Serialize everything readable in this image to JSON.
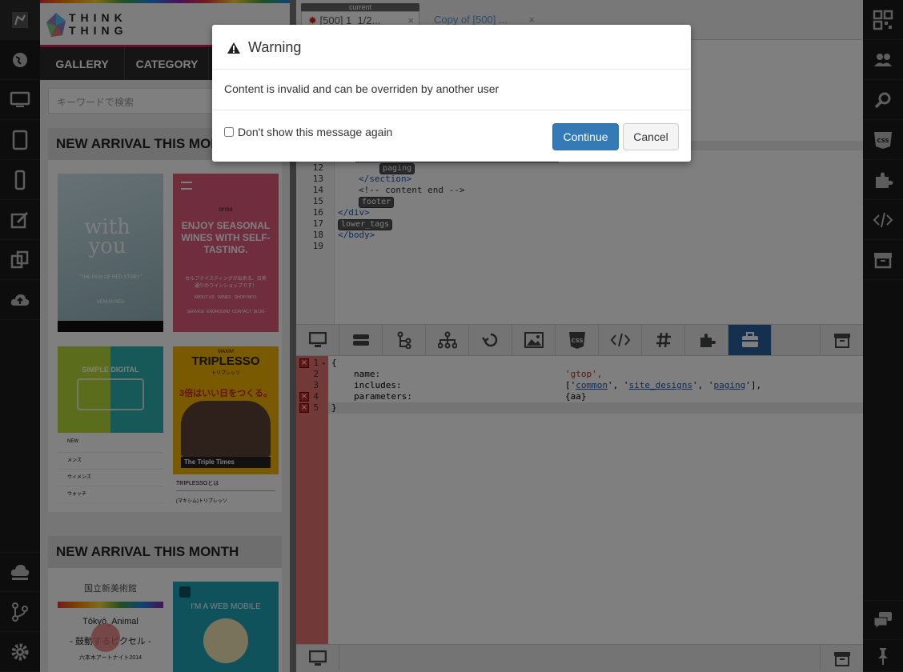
{
  "preview": {
    "logo_line1": "THINK",
    "logo_line2": "THING",
    "nav": [
      "GALLERY",
      "CATEGORY"
    ],
    "search_placeholder": "キーワードで検索",
    "section1_title": "NEW ARRIVAL THIS MONTH",
    "section2_title": "NEW ARRIVAL THIS MONTH",
    "thumb1": {
      "title1": "with",
      "title2": "you",
      "sub": "\"THE FILM OF RED STORY\"",
      "brand": "VENUS RED"
    },
    "thumb2": {
      "brand": "ornis",
      "headline": "ENJOY SEASONAL WINES WITH SELF-TASTING.",
      "jp": "セルフテイスティングが出来る、日美通りのワインショップです！",
      "links1": "ABOUT US   WINES   SHOP INFO.",
      "links2": "SERVICE  ENOROUND  CONTACT  BLOG"
    },
    "thumb3": {
      "title": "SIMPLE DIGITAL",
      "menu": [
        "NEW",
        "メンズ",
        "ウィメンズ",
        "ウォッチ"
      ]
    },
    "thumb4": {
      "small": "MAXIM",
      "title": "TRIPLESSO",
      "kana": "トリプレッソ",
      "jp": "3倍はいい日をつくる。",
      "banner": "The Triple Times",
      "link1": "TRIPLESSOとは",
      "link2": "(マキシム)トリプレッソ"
    },
    "thumb5": {
      "museum": "国立新美術館",
      "event1": "Tōkyō_Animal",
      "event2": "- 鼓動するピクセル -",
      "event3": "六本木アートナイト2014"
    },
    "thumb6": {
      "title": "I'M A WEB MOBILE"
    }
  },
  "tabs": {
    "current_label": "current",
    "tab1": "[500] 1_1/2...",
    "tab2": "Copy of [500] ...",
    "close": "×"
  },
  "html_code": {
    "line_numbers": [
      "12",
      "13",
      "14",
      "15",
      "16",
      "17",
      "18",
      "19"
    ],
    "paging_chip": "paging",
    "section_close": "</section>",
    "comment": "<!-- content end -->",
    "footer_chip": "footer",
    "div_close": "</div>",
    "lower_tags_chip": "lower_tags",
    "body_close": "</body>"
  },
  "json_code": {
    "line_numbers": [
      "1",
      "2",
      "3",
      "4",
      "5"
    ],
    "open": "{",
    "name_key": "name:",
    "name_val": "'gtop',",
    "includes_key": "includes:",
    "inc_open": "['",
    "inc1": "common",
    "inc_sep1": "', '",
    "inc2": "site_designs",
    "inc_sep2": "', '",
    "inc3": "paging",
    "inc_close": "'],",
    "params_key": "parameters:",
    "params_val": "{aa}",
    "close": "}"
  },
  "modal": {
    "title": "Warning",
    "message": "Content is invalid and can be overriden by another user",
    "checkbox_label": "Don't show this message again",
    "checkbox_checked": false,
    "continue_label": "Continue",
    "cancel_label": "Cancel"
  },
  "colors": {
    "primary": "#337ab7",
    "error_gutter": "#e57373",
    "active_tool": "#2a5f9e"
  }
}
